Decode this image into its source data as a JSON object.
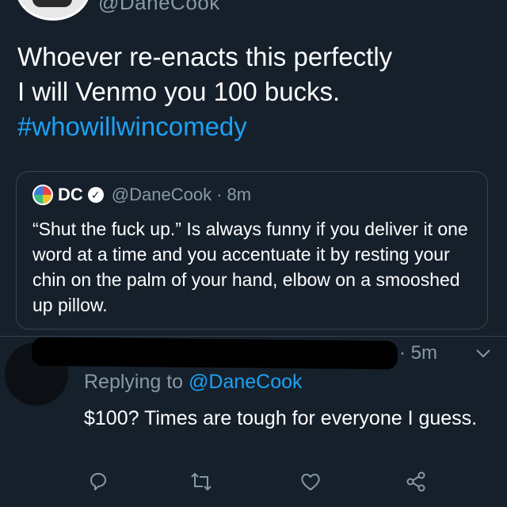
{
  "top": {
    "handle_fragment": "@DaneCook"
  },
  "tweet": {
    "line1": "Whoever re-enacts this perfectly",
    "line2": "I will Venmo you 100 bucks.",
    "hashtag": "#whowillwincomedy"
  },
  "quote": {
    "name": "DC",
    "handle": "@DaneCook",
    "time": "· 8m",
    "text": "“Shut the fuck up.” Is always funny if you deliver it one word at a time and you accentuate it by resting your chin on the palm of your hand, elbow on a smooshed up pillow."
  },
  "reply": {
    "time": "· 5m",
    "replying_prefix": "Replying to ",
    "replying_handle": "@DaneCook",
    "text": "$100? Times are tough for everyone I guess."
  },
  "colors": {
    "background": "#15202b",
    "link": "#1da1f2",
    "muted": "#8899a6",
    "border": "#38444d"
  },
  "icons": [
    "comment-icon",
    "retweet-icon",
    "like-icon",
    "share-icon",
    "chevron-down-icon",
    "verified-badge-icon"
  ]
}
